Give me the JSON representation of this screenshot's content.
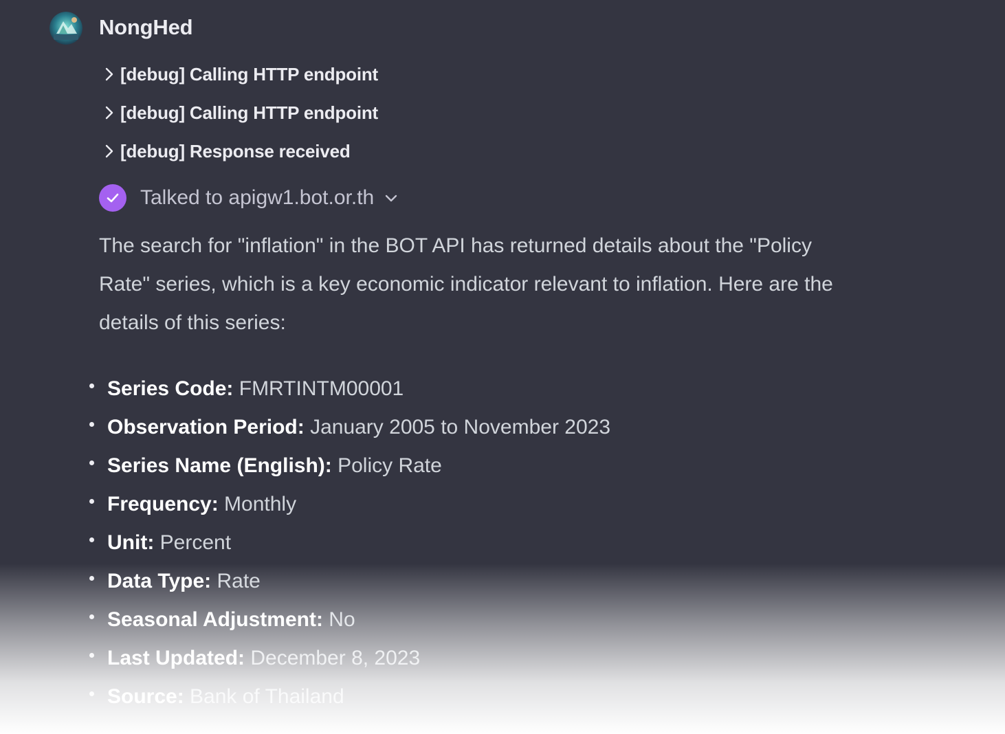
{
  "message": {
    "author": "NongHed",
    "debug_entries": [
      {
        "label": "[debug] Calling HTTP endpoint"
      },
      {
        "label": "[debug] Calling HTTP endpoint"
      },
      {
        "label": "[debug] Response received"
      }
    ],
    "plugin": {
      "status_text": "Talked to apigw1.bot.or.th",
      "status_color": "#a461f0"
    },
    "intro": "The search for \"inflation\" in the BOT API has returned details about the \"Policy Rate\" series, which is a key economic indicator relevant to inflation. Here are the details of this series:",
    "details": [
      {
        "key": "Series Code:",
        "value": " FMRTINTM00001"
      },
      {
        "key": "Observation Period:",
        "value": " January 2005 to November 2023"
      },
      {
        "key": "Series Name (English):",
        "value": " Policy Rate"
      },
      {
        "key": "Frequency:",
        "value": " Monthly"
      },
      {
        "key": "Unit:",
        "value": " Percent"
      },
      {
        "key": "Data Type:",
        "value": " Rate"
      },
      {
        "key": "Seasonal Adjustment:",
        "value": " No"
      },
      {
        "key": "Last Updated:",
        "value": " December 8, 2023"
      },
      {
        "key": "Source:",
        "value": " Bank of Thailand"
      }
    ]
  },
  "icons": {
    "avatar": "bot-avatar-icon",
    "debug_chevron": "chevron-right-icon",
    "status": "check-circle-icon",
    "expand": "chevron-down-icon"
  },
  "colors": {
    "background": "#343541",
    "accent": "#a461f0"
  }
}
